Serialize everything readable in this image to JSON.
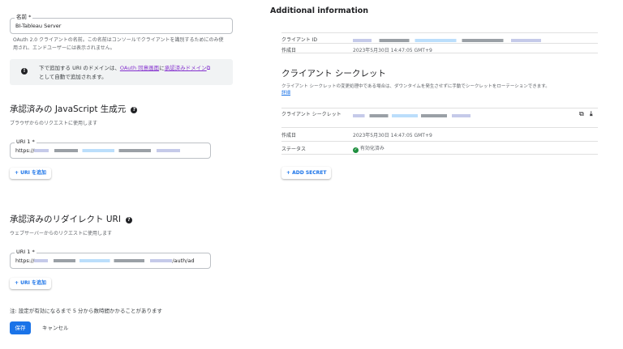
{
  "name_field": {
    "label": "名前 *",
    "value": "BI-Tableau Server",
    "helper": "OAuth 2.0 クライアントの名前。この名前はコンソールでクライアントを識別するためにのみ使用され、エンドユーザーには表示されません。"
  },
  "info": {
    "text1": "下で追加する URI のドメインは、",
    "link1": "OAuth 同意画面",
    "text2": "に",
    "link2": "承認済みドメイン",
    "text3": "として自動で追加されます。"
  },
  "js_origins": {
    "title": "承認済みの JavaScript 生成元",
    "subtitle": "ブラウザからのリクエストに使用します",
    "uri_label": "URI 1 *",
    "uri_prefix": "https://",
    "add_label": "URI を追加"
  },
  "redirect": {
    "title": "承認済みのリダイレクト URI",
    "subtitle": "ウェブサーバーからのリクエストに使用します",
    "uri_label": "URI 1 *",
    "uri_prefix": "https://",
    "uri_suffix": "/auth/ad",
    "add_label": "URI を追加"
  },
  "note": "注: 設定が有効になるまで 5 分から数時間かかることがあります",
  "save_label": "保存",
  "cancel_label": "キャンセル",
  "additional": {
    "title": "Additional information",
    "client_id_label": "クライアント ID",
    "created_label": "作成日",
    "created_value": "2023年5月30日 14:47:05 GMT+9"
  },
  "secret": {
    "title": "クライアント シークレット",
    "desc": "クライアント シークレットの変更処理中である場合は、ダウンタイムを発生させずに手動でシークレットをローテーションできます。",
    "link": "詳細",
    "secret_label": "クライアント シークレット",
    "created_label": "作成日",
    "created_value": "2023年5月30日 14:47:05 GMT+9",
    "status_label": "ステータス",
    "status_value": "有効化済み",
    "add_label": "ADD SECRET"
  },
  "colors": {
    "accent": "#1a73e8",
    "success": "#1e8e3e",
    "link": "#8430ce"
  }
}
